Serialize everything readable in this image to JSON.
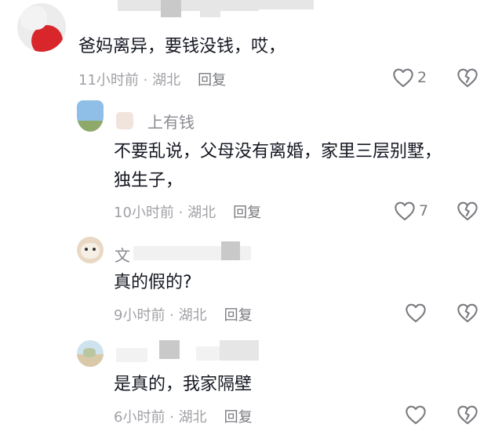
{
  "comments": [
    {
      "username": "",
      "text": "爸妈离异，要钱没钱，哎，",
      "time": "11小时前",
      "location": "湖北",
      "reply_label": "回复",
      "like_count": "2"
    },
    {
      "username": "上有钱",
      "text_line1": "不要乱说，父母没有离婚，家里三层别墅，",
      "text_line2": "独生子，",
      "time": "10小时前",
      "location": "湖北",
      "reply_label": "回复",
      "like_count": "7"
    },
    {
      "username": "文",
      "text": "真的假的?",
      "time": "9小时前",
      "location": "湖北",
      "reply_label": "回复",
      "like_count": ""
    },
    {
      "username": "",
      "text": "是真的，我家隔壁",
      "time": "6小时前",
      "location": "湖北",
      "reply_label": "回复",
      "like_count": ""
    }
  ],
  "meta_separator": " · ",
  "icons": {
    "like": "heart-outline-icon",
    "dislike": "broken-heart-icon"
  },
  "colors": {
    "text": "#161823",
    "secondary": "#a0a1a6",
    "icon": "#7a7b80"
  }
}
